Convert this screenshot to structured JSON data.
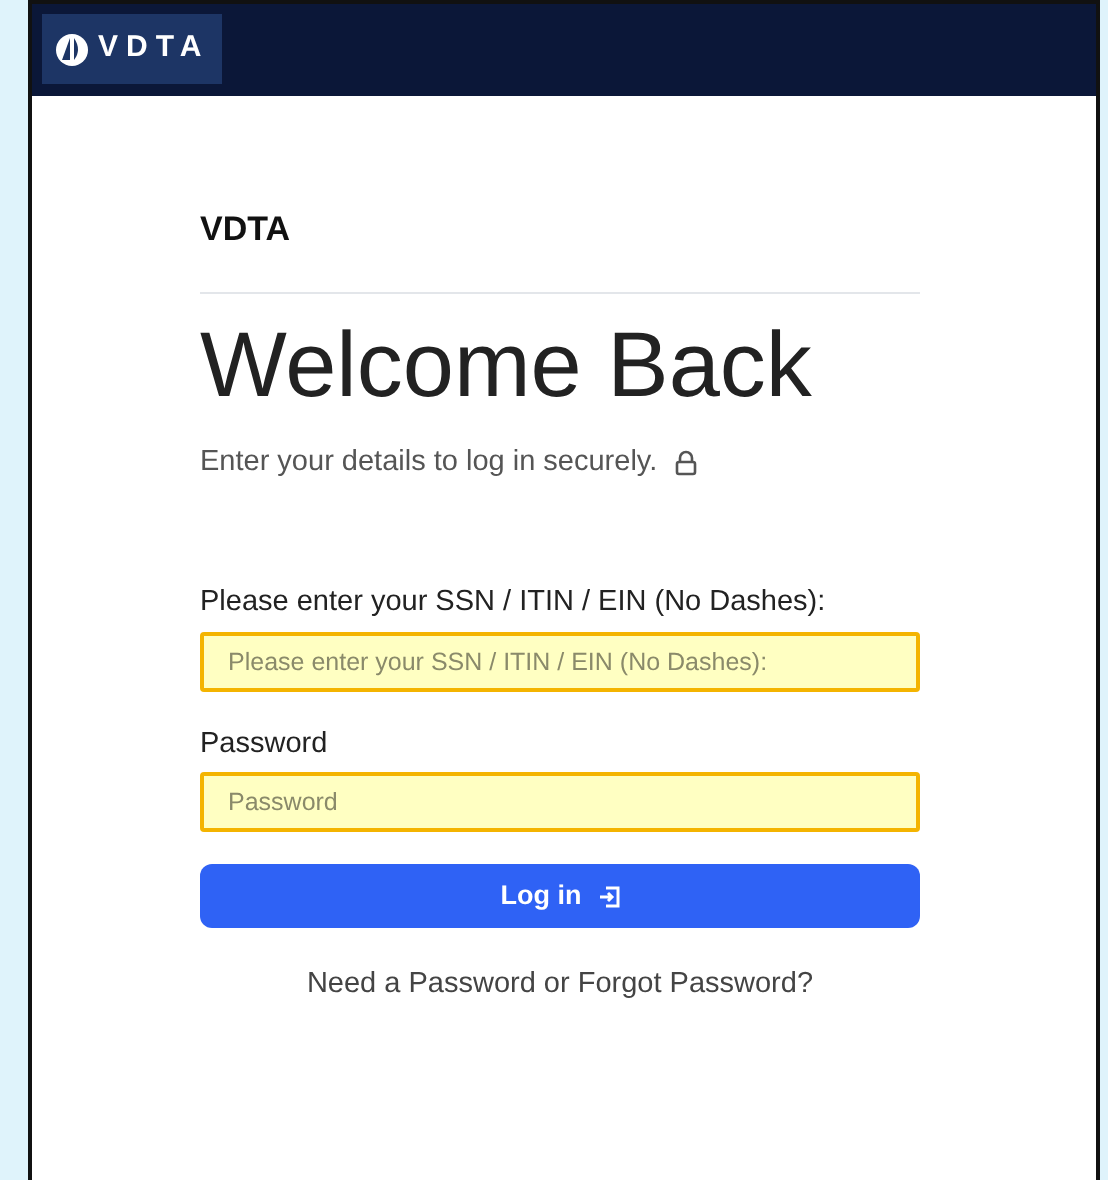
{
  "navbar": {
    "logo_text": "VDTA"
  },
  "form": {
    "brand": "VDTA",
    "title": "Welcome Back",
    "subtitle": "Enter your details to log in securely.",
    "fields": [
      {
        "label": "Please enter your SSN / ITIN / EIN (No Dashes):",
        "placeholder": "Please enter your SSN / ITIN / EIN (No Dashes):"
      },
      {
        "label": "Password",
        "placeholder": "Password"
      }
    ],
    "submit": "Log in",
    "help_link": "Need a Password or Forgot Password?"
  }
}
